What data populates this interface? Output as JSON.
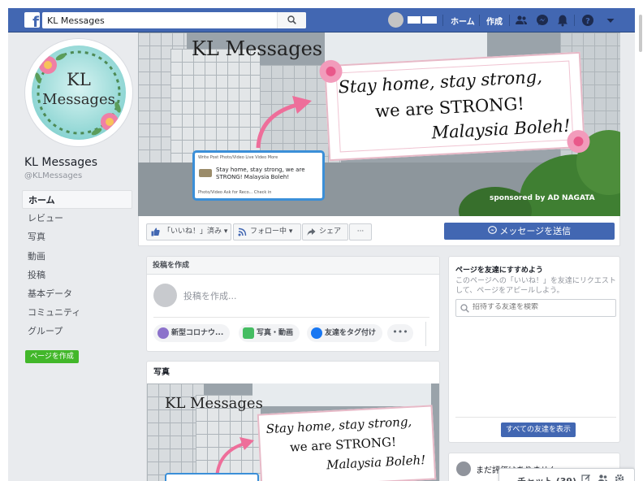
{
  "topbar": {
    "logo": "f",
    "search_value": "KL Messages",
    "nav": {
      "home": "ホーム",
      "create": "作成"
    },
    "icons": [
      "friends-icon",
      "messenger-icon",
      "notifications-icon",
      "help-icon",
      "dropdown-icon"
    ]
  },
  "page": {
    "profile_line1": "KL",
    "profile_line2": "Messages",
    "name": "KL Messages",
    "handle": "@KLMessages"
  },
  "left_nav": {
    "items": [
      {
        "label": "ホーム",
        "active": true
      },
      {
        "label": "レビュー"
      },
      {
        "label": "写真"
      },
      {
        "label": "動画"
      },
      {
        "label": "投稿"
      },
      {
        "label": "基本データ"
      },
      {
        "label": "コミュニティ"
      },
      {
        "label": "グループ"
      }
    ],
    "create_page": "ページを作成"
  },
  "cover": {
    "title": "KL Messages",
    "sign_line1": "Stay home, stay strong,",
    "sign_line2": "we are STRONG!",
    "sign_line3": "Malaysia Boleh!",
    "post_toolbar": "Write Post   Photo/Video   Live Video   More",
    "post_text": "Stay home, stay strong, we are STRONG! Malaysia Boleh!",
    "post_actions": "Photo/Video   Ask for Reco...   Check in",
    "sponsor": "sponsored by AD NAGATA"
  },
  "actions": {
    "like": "「いいね！」済み",
    "follow": "フォロー中",
    "share": "シェア",
    "more": "···",
    "message": "メッセージを送信"
  },
  "create_post": {
    "header": "投稿を作成",
    "placeholder": "投稿を作成...",
    "chips": [
      "新型コロナウ...",
      "写真・動画",
      "友達をタグ付け"
    ],
    "more": "•••"
  },
  "photos": {
    "header": "写真",
    "title": "KL Messages",
    "sign_line1": "Stay home, stay strong,",
    "sign_line2": "we are STRONG!",
    "sign_line3": "Malaysia Boleh!"
  },
  "invite": {
    "title": "ページを友達にすすめよう",
    "desc": "このページへの「いいね！」を友達にリクエストして、ページをアピールしよう。",
    "search_placeholder": "招待する友達を検索",
    "button": "すべての友達を表示"
  },
  "rating": {
    "text": "まだ評価はありません"
  },
  "chat": {
    "label": "チャット (39)"
  },
  "colors": {
    "facebook_blue": "#4267b2",
    "green": "#42b72a",
    "background": "#e9ebee"
  }
}
